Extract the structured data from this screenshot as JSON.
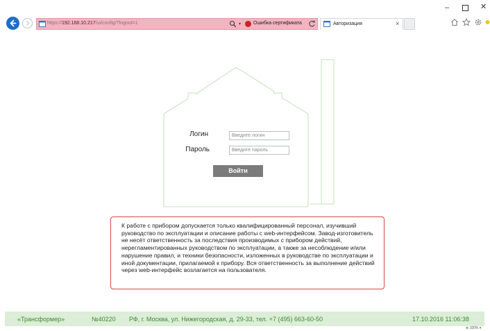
{
  "browser": {
    "url_prefix": "https://",
    "url_host": "192.168.10.217",
    "url_path": "/ui/config/?logout=1",
    "cert_error": "Ошибка сертификата",
    "tab_title": "Авторизация",
    "zoom": "100%"
  },
  "login": {
    "login_label": "Логин",
    "login_placeholder": "Введите логин",
    "password_label": "Пароль",
    "password_placeholder": "Введите пароль",
    "submit_label": "Войти"
  },
  "warning": {
    "text": "К работе с прибором допускается только квалифицированный персонал, изучивший руководство по эксплуатации и описание работы с web-интерфейсом. Завод-изготовитель не несёт ответственность за последствия производимых с прибором действий, нерегламентированных руководством по эксплуатации, а также за несоблюдение и/или нарушение правил, и техники безопасности, изложенных в руководстве по эксплуатации и иной документации, прилагаемой к прибору. Вся ответственность за выполнение действий через web-интерфейс возлагается на пользователя."
  },
  "footer": {
    "brand": "«Трансформер»",
    "serial": "№40220",
    "address": "РФ, г. Москва, ул. Нижегородская, д. 29-33, тел. +7 (495) 663-60-50",
    "datetime": "17.10.2016 11:06:38"
  },
  "colors": {
    "accent_green": "#3d8a2f",
    "footer_bg": "#dcedd8",
    "house_outline": "#cfe8c9",
    "warning_border": "#d64545",
    "button_bg": "#7b7b7b",
    "address_bar_error": "#f2b4c0"
  }
}
